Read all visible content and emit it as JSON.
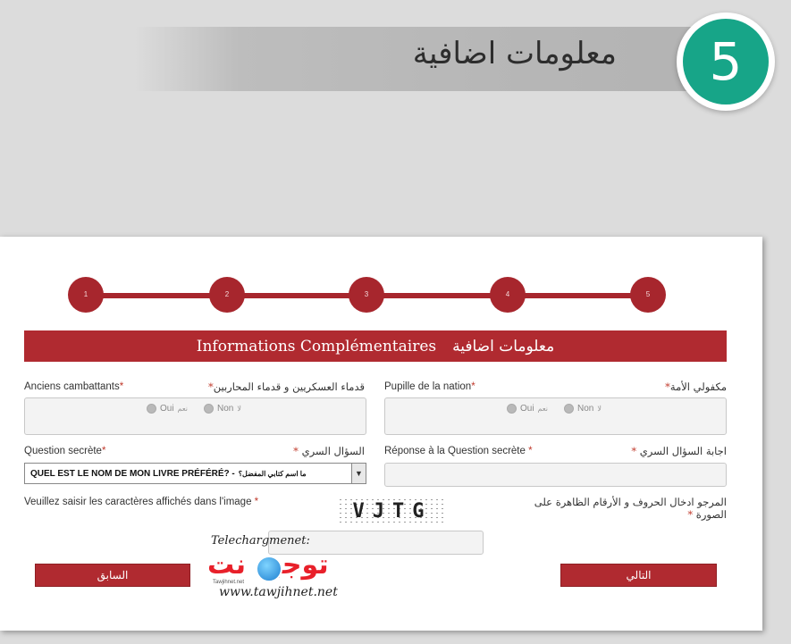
{
  "header": {
    "title": "معلومات اضافية",
    "step_number": "5",
    "accent_color": "#17a588"
  },
  "progress": {
    "steps": [
      "1",
      "2",
      "3",
      "4",
      "5"
    ],
    "current": 5,
    "color": "#a7262d"
  },
  "section": {
    "title_fr": "Informations Complémentaires",
    "title_ar": "معلومات اضافية"
  },
  "fields": {
    "anciens": {
      "label_fr": "Anciens cambattants",
      "label_ar": "قدماء العسكريين و قدماء المحاربين",
      "required_mark": "*",
      "option_oui_fr": "Oui",
      "option_oui_ar": "نعم",
      "option_non_fr": "Non",
      "option_non_ar": "لا"
    },
    "pupille": {
      "label_fr": "Pupille de la nation",
      "label_ar": "مكفولي الأمة",
      "required_mark": "*",
      "option_oui_fr": "Oui",
      "option_oui_ar": "نعم",
      "option_non_fr": "Non",
      "option_non_ar": "لا"
    },
    "question": {
      "label_fr": "Question secrète",
      "label_ar": "السؤال السري",
      "required_mark": "*",
      "selected_value": "QUEL EST LE NOM DE MON LIVRE PRÉFÉRÉ? -",
      "selected_value_ar": "ما اسم كتابي المفضل؟"
    },
    "reponse": {
      "label_fr": "Réponse à la Question secrète",
      "label_ar": "اجابة السؤال السري",
      "required_mark": "*",
      "value": ""
    },
    "captcha": {
      "label_fr": "Veuillez saisir les caractères affichés dans l'image",
      "label_ar": "المرجو ادخال الحروف و الأرقام الظاهرة على الصورة",
      "required_mark": "*",
      "image_text": "VJTG",
      "value": ""
    }
  },
  "buttons": {
    "previous": "السابق",
    "next": "التالي"
  },
  "watermark": {
    "line1": "Telechargmenet:",
    "logo_text": "توجيه نت",
    "small_text": "Tawjihnet.net",
    "url": "www.tawjihnet.net"
  }
}
